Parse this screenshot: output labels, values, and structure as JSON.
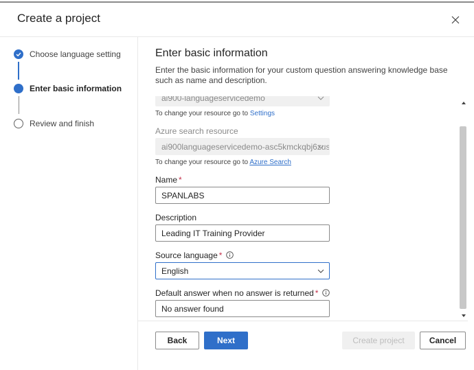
{
  "dialog": {
    "title": "Create a project",
    "close_icon": "close-icon"
  },
  "steps": [
    {
      "label": "Choose language setting",
      "state": "completed"
    },
    {
      "label": "Enter basic information",
      "state": "current"
    },
    {
      "label": "Review and finish",
      "state": "pending"
    }
  ],
  "main": {
    "title": "Enter basic information",
    "description": "Enter the basic information for your custom question answering knowledge base such as name and description."
  },
  "form": {
    "language_resource": {
      "value": "ai900-languageservicedemo",
      "hint_prefix": "To change your resource go to ",
      "hint_link": "Settings"
    },
    "search_resource": {
      "label": "Azure search resource",
      "value": "ai900languageservicedemo-asc5kmckqbj6zus",
      "hint_prefix": "To change your resource go to ",
      "hint_link": "Azure Search"
    },
    "name": {
      "label": "Name",
      "required_mark": "*",
      "value": "SPANLABS"
    },
    "description": {
      "label": "Description",
      "value": "Leading IT Training Provider"
    },
    "source_language": {
      "label": "Source language",
      "required_mark": "*",
      "value": "English"
    },
    "default_answer": {
      "label": "Default answer when no answer is returned",
      "required_mark": "*",
      "value": "No answer found"
    }
  },
  "footer": {
    "back_label": "Back",
    "next_label": "Next",
    "create_label": "Create project",
    "cancel_label": "Cancel"
  },
  "colors": {
    "accent": "#2f6fc9",
    "required": "#c4314b",
    "disabled_bg": "#f0f0f0"
  }
}
